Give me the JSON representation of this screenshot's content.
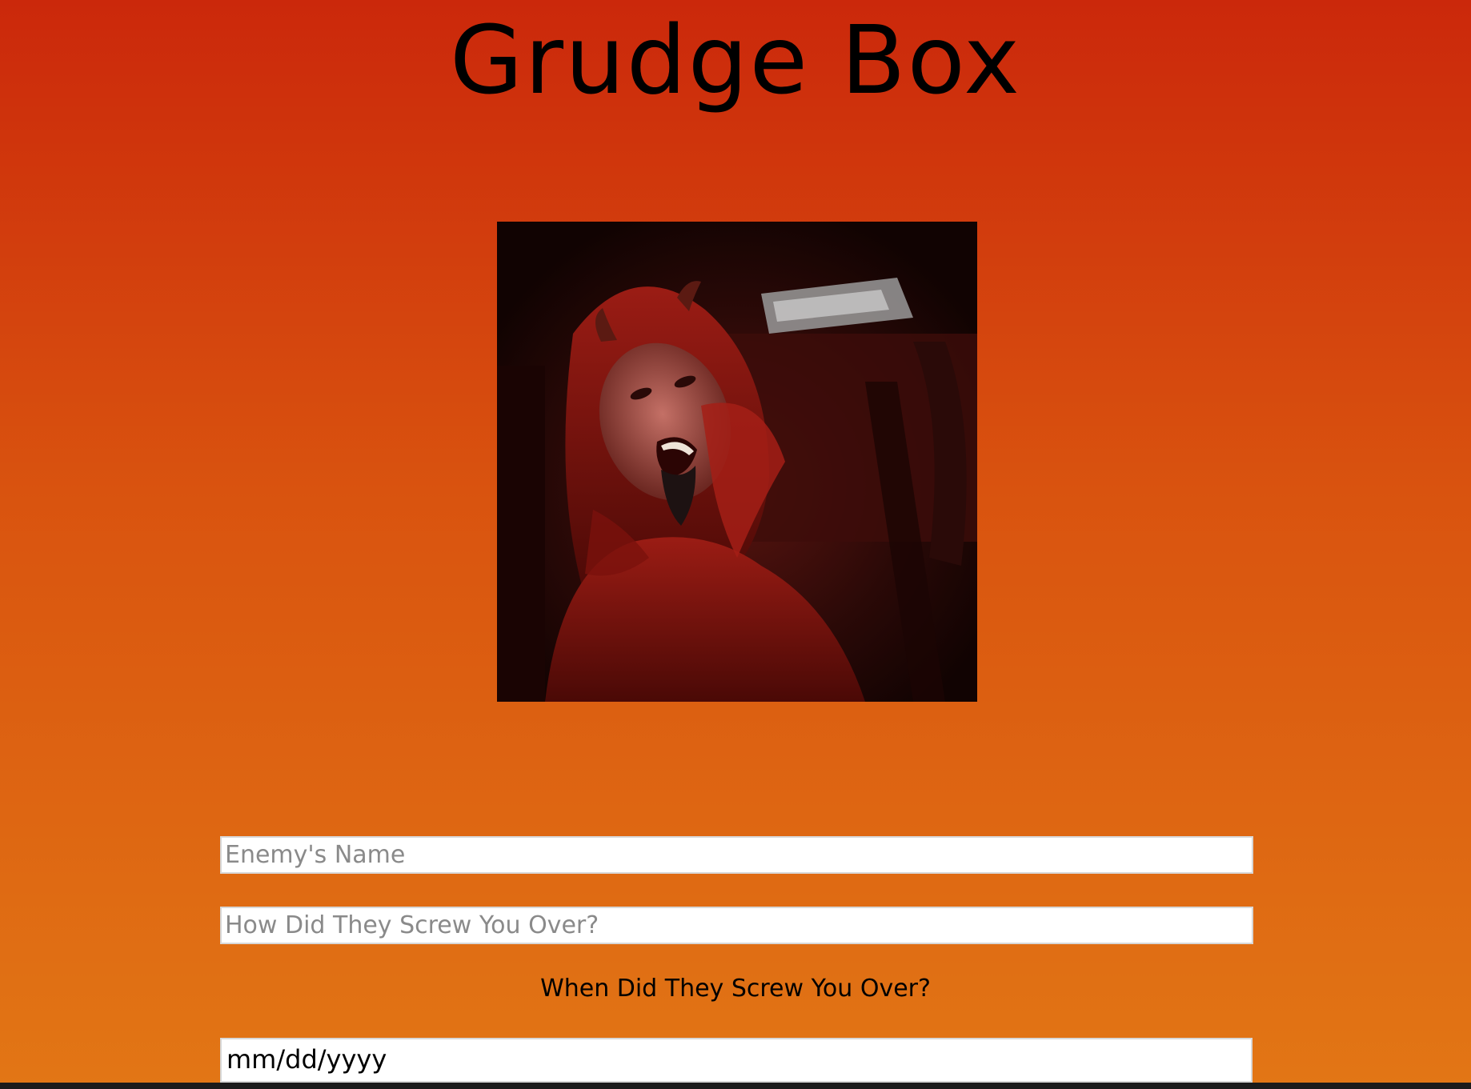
{
  "header": {
    "title": "Grudge Box"
  },
  "hero": {
    "image_name": "devil-costume-photo"
  },
  "form": {
    "enemy_name_placeholder": "Enemy's Name",
    "screw_how_placeholder": "How Did They Screw You Over?",
    "date_label": "When Did They Screw You Over?",
    "date_placeholder": "mm/dd/yyyy"
  },
  "colors": {
    "background_top": "#cb280b",
    "background_bottom": "#e27615"
  }
}
